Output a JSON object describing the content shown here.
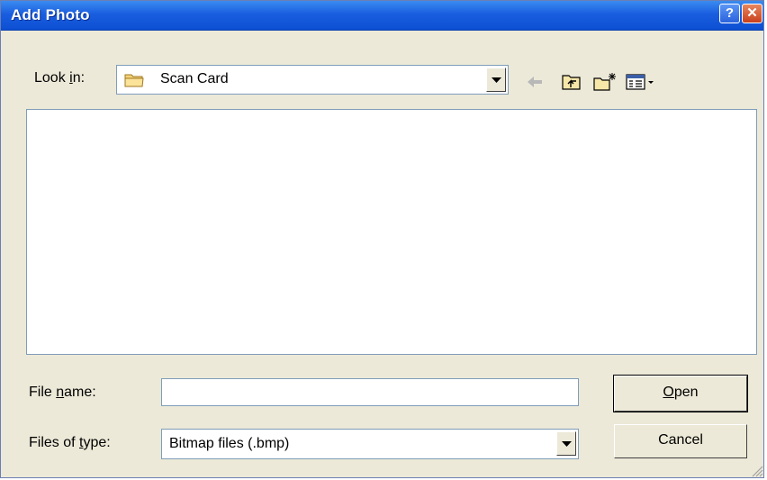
{
  "window": {
    "title": "Add Photo",
    "help_glyph": "?",
    "close_glyph": "✕"
  },
  "look_in": {
    "label_pre": "Look ",
    "label_key": "i",
    "label_post": "n:",
    "value": "Scan Card",
    "icon": "folder-icon"
  },
  "toolbar": {
    "icons": [
      "back-arrow-icon",
      "up-folder-icon",
      "new-folder-icon",
      "views-menu-icon"
    ]
  },
  "file_name": {
    "label_pre": "File ",
    "label_key": "n",
    "label_post": "ame:",
    "value": ""
  },
  "file_type": {
    "label_pre": "Files of ",
    "label_key": "t",
    "label_post": "ype:",
    "value": "Bitmap files (.bmp)"
  },
  "buttons": {
    "open_key": "O",
    "open_rest": "pen",
    "cancel": "Cancel"
  }
}
